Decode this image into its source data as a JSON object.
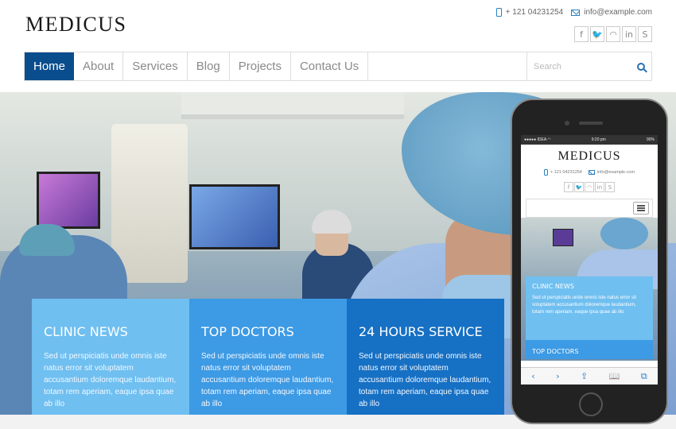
{
  "brand": {
    "logo": "MEDICUS"
  },
  "contact": {
    "phone": "+ 121 04231254",
    "email": "info@example.com"
  },
  "social": [
    {
      "icon": "facebook-icon",
      "glyph": "f"
    },
    {
      "icon": "twitter-icon",
      "glyph": "🐦"
    },
    {
      "icon": "rss-icon",
      "glyph": "◠"
    },
    {
      "icon": "linkedin-icon",
      "glyph": "in"
    },
    {
      "icon": "skype-icon",
      "glyph": "S"
    }
  ],
  "nav": {
    "items": [
      "Home",
      "About",
      "Services",
      "Blog",
      "Projects",
      "Contact Us"
    ],
    "active": "Home",
    "search_placeholder": "Search"
  },
  "features": [
    {
      "title": "Clinic News",
      "body": "Sed ut perspiciatis unde omnis iste natus error sit voluptatem accusantium doloremque laudantium, totam rem aperiam, eaque ipsa quae ab illo",
      "color": "#6fbff0"
    },
    {
      "title": "Top Doctors",
      "body": "Sed ut perspiciatis unde omnis iste natus error sit voluptatem accusantium doloremque laudantium, totam rem aperiam, eaque ipsa quae ab illo",
      "color": "#3d9ae4"
    },
    {
      "title": "24 Hours Service",
      "body": "Sed ut perspiciatis unde omnis iste natus error sit voluptatem accusantium doloremque laudantium, totam rem aperiam, eaque ipsa quae ab illo",
      "color": "#1670c4"
    }
  ],
  "mobile": {
    "status_left": "●●●●● IDEA ◠",
    "status_time": "9:20 pm",
    "status_right": "90%",
    "logo": "MEDICUS",
    "phone": "+ 121 04231254",
    "email": "info@example.com",
    "news_title": "Clinic News",
    "news_body": "Sed ut perspiciatis unde omnis iste natus error sit voluptatem accusantium doloremque laudantium, totam rem aperiam, eaque ipsa quae ab illo",
    "next_title": "Top Doctors"
  },
  "colors": {
    "accent": "#0a4d8c",
    "box1": "#6fbff0",
    "box2": "#3d9ae4",
    "box3": "#1670c4"
  }
}
